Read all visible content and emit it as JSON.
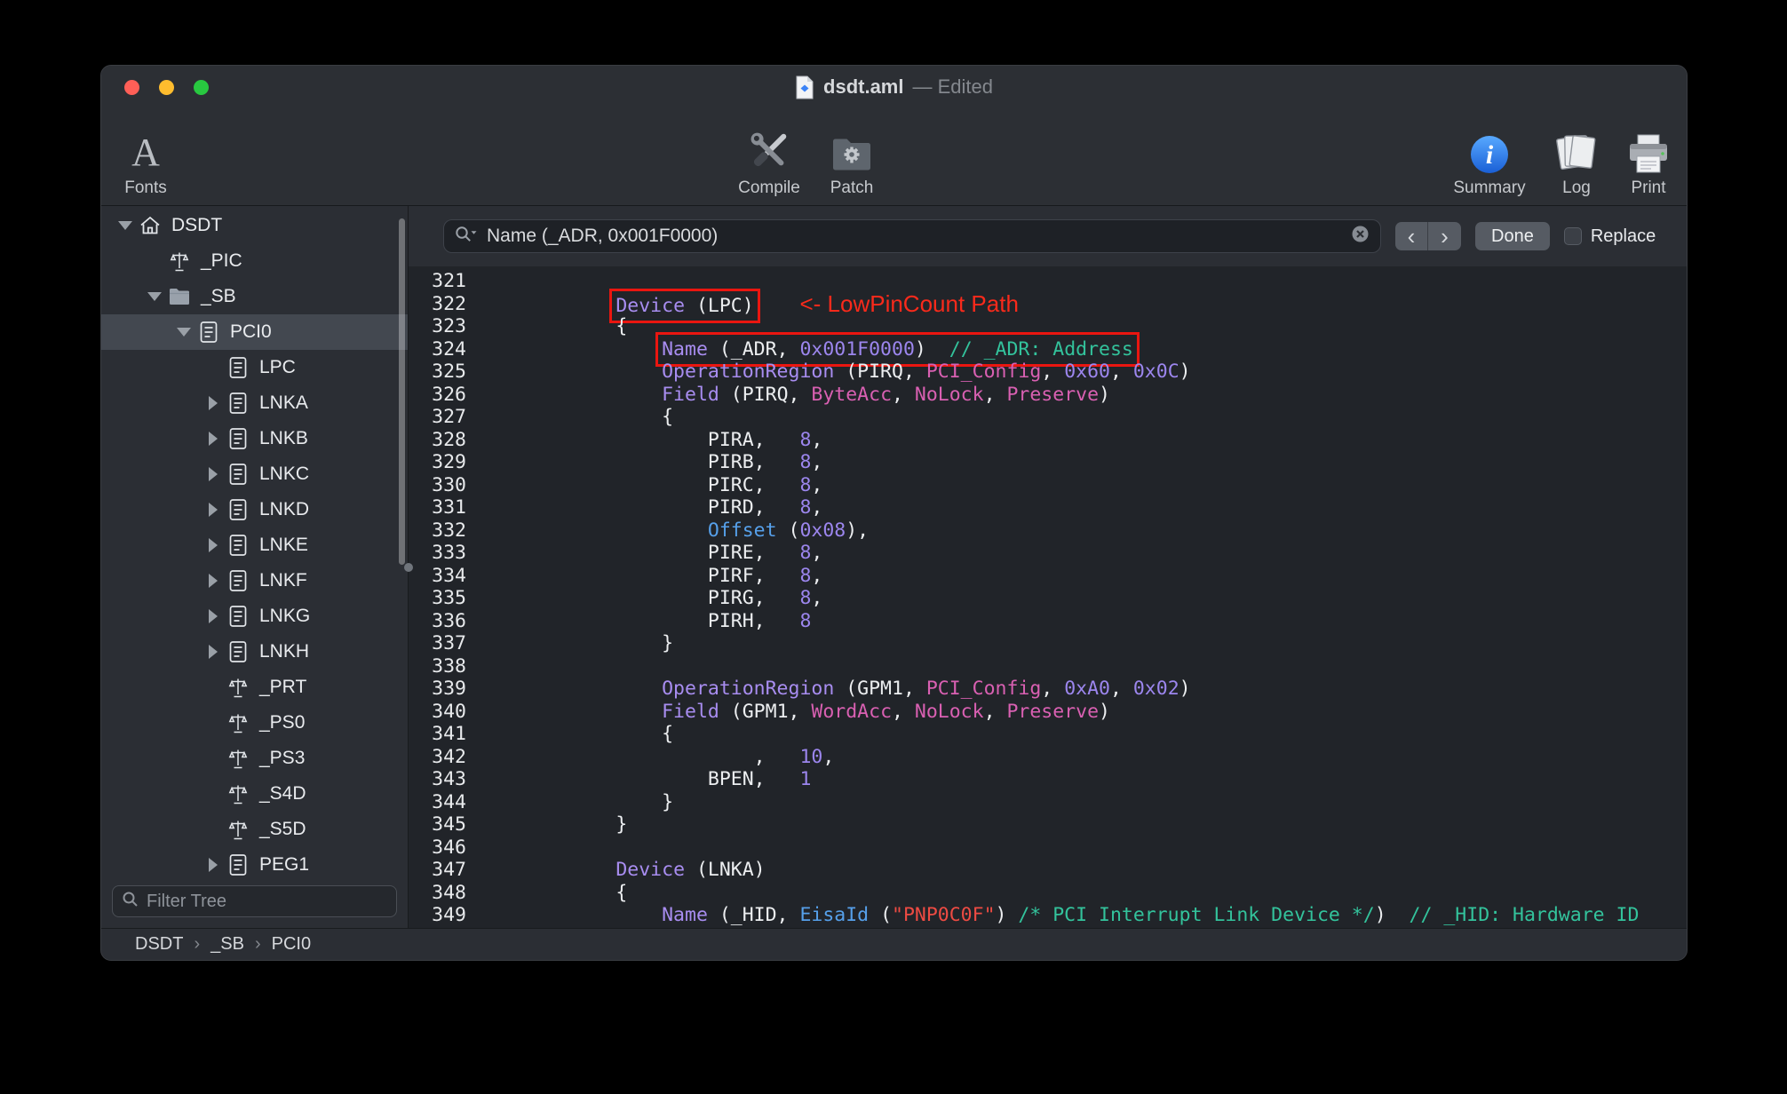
{
  "window": {
    "title_file": "dsdt.aml",
    "title_suffix": "— Edited"
  },
  "toolbar": {
    "items": [
      {
        "label": "Fonts"
      },
      {
        "label": "Compile"
      },
      {
        "label": "Patch"
      },
      {
        "label": "Summary"
      },
      {
        "label": "Log"
      },
      {
        "label": "Print"
      }
    ]
  },
  "sidebar": {
    "filter_placeholder": "Filter Tree",
    "tree": [
      {
        "label": "DSDT",
        "depth": 0,
        "icon": "house",
        "disclosure": "open",
        "selected": false
      },
      {
        "label": "_PIC",
        "depth": 1,
        "icon": "method",
        "disclosure": "none",
        "selected": false
      },
      {
        "label": "_SB",
        "depth": 1,
        "icon": "folder",
        "disclosure": "open",
        "selected": false
      },
      {
        "label": "PCI0",
        "depth": 2,
        "icon": "device",
        "disclosure": "open",
        "selected": true
      },
      {
        "label": "LPC",
        "depth": 3,
        "icon": "device",
        "disclosure": "none",
        "selected": false
      },
      {
        "label": "LNKA",
        "depth": 3,
        "icon": "device",
        "disclosure": "closed",
        "selected": false
      },
      {
        "label": "LNKB",
        "depth": 3,
        "icon": "device",
        "disclosure": "closed",
        "selected": false
      },
      {
        "label": "LNKC",
        "depth": 3,
        "icon": "device",
        "disclosure": "closed",
        "selected": false
      },
      {
        "label": "LNKD",
        "depth": 3,
        "icon": "device",
        "disclosure": "closed",
        "selected": false
      },
      {
        "label": "LNKE",
        "depth": 3,
        "icon": "device",
        "disclosure": "closed",
        "selected": false
      },
      {
        "label": "LNKF",
        "depth": 3,
        "icon": "device",
        "disclosure": "closed",
        "selected": false
      },
      {
        "label": "LNKG",
        "depth": 3,
        "icon": "device",
        "disclosure": "closed",
        "selected": false
      },
      {
        "label": "LNKH",
        "depth": 3,
        "icon": "device",
        "disclosure": "closed",
        "selected": false
      },
      {
        "label": "_PRT",
        "depth": 3,
        "icon": "method",
        "disclosure": "none",
        "selected": false
      },
      {
        "label": "_PS0",
        "depth": 3,
        "icon": "method",
        "disclosure": "none",
        "selected": false
      },
      {
        "label": "_PS3",
        "depth": 3,
        "icon": "method",
        "disclosure": "none",
        "selected": false
      },
      {
        "label": "_S4D",
        "depth": 3,
        "icon": "method",
        "disclosure": "none",
        "selected": false
      },
      {
        "label": "_S5D",
        "depth": 3,
        "icon": "method",
        "disclosure": "none",
        "selected": false
      },
      {
        "label": "PEG1",
        "depth": 3,
        "icon": "device",
        "disclosure": "closed",
        "selected": false
      }
    ]
  },
  "findbar": {
    "search_value": "Name (_ADR, 0x001F0000)",
    "prev_label": "‹",
    "next_label": "›",
    "done_label": "Done",
    "replace_label": "Replace",
    "replace_checked": false
  },
  "annotation": {
    "note": "<- LowPinCount Path",
    "box_color": "#ea1610"
  },
  "colors": {
    "traffic_close": "#ff5f57",
    "traffic_minimize": "#febc2e",
    "traffic_zoom": "#28c840",
    "keyword": "#a88df0",
    "number": "#9c86ee",
    "predefined": "#d960b2",
    "comment": "#33c39c",
    "string": "#ee4b43",
    "function": "#56a0ea",
    "annotation_red": "#ea1610"
  },
  "breadcrumb": [
    "DSDT",
    "_SB",
    "PCI0"
  ],
  "editor": {
    "first_line": 321,
    "lines": [
      [],
      [
        {
          "c": "pln",
          "t": "            "
        },
        {
          "box": [
            {
              "c": "kw",
              "t": "Device"
            },
            {
              "c": "pln",
              "t": " (LPC)"
            }
          ]
        },
        {
          "c": "pln",
          "t": "    "
        },
        {
          "c": "note",
          "t": "<- LowPinCount Path"
        }
      ],
      [
        {
          "c": "pln",
          "t": "            {"
        }
      ],
      [
        {
          "c": "pln",
          "t": "                "
        },
        {
          "box": [
            {
              "c": "kw",
              "t": "Name"
            },
            {
              "c": "pln",
              "t": " (_ADR, "
            },
            {
              "c": "num",
              "t": "0x001F0000"
            },
            {
              "c": "pln",
              "t": ")  "
            },
            {
              "c": "com",
              "t": "// _ADR: Address"
            }
          ]
        }
      ],
      [
        {
          "c": "pln",
          "t": "                "
        },
        {
          "c": "kw",
          "t": "OperationRegion"
        },
        {
          "c": "pln",
          "t": " (PIRQ, "
        },
        {
          "c": "pre",
          "t": "PCI_Config"
        },
        {
          "c": "pln",
          "t": ", "
        },
        {
          "c": "num",
          "t": "0x60"
        },
        {
          "c": "pln",
          "t": ", "
        },
        {
          "c": "num",
          "t": "0x0C"
        },
        {
          "c": "pln",
          "t": ")"
        }
      ],
      [
        {
          "c": "pln",
          "t": "                "
        },
        {
          "c": "kw",
          "t": "Field"
        },
        {
          "c": "pln",
          "t": " (PIRQ, "
        },
        {
          "c": "pre",
          "t": "ByteAcc"
        },
        {
          "c": "pln",
          "t": ", "
        },
        {
          "c": "pre",
          "t": "NoLock"
        },
        {
          "c": "pln",
          "t": ", "
        },
        {
          "c": "pre",
          "t": "Preserve"
        },
        {
          "c": "pln",
          "t": ")"
        }
      ],
      [
        {
          "c": "pln",
          "t": "                {"
        }
      ],
      [
        {
          "c": "pln",
          "t": "                    PIRA,   "
        },
        {
          "c": "num",
          "t": "8"
        },
        {
          "c": "pln",
          "t": ","
        }
      ],
      [
        {
          "c": "pln",
          "t": "                    PIRB,   "
        },
        {
          "c": "num",
          "t": "8"
        },
        {
          "c": "pln",
          "t": ","
        }
      ],
      [
        {
          "c": "pln",
          "t": "                    PIRC,   "
        },
        {
          "c": "num",
          "t": "8"
        },
        {
          "c": "pln",
          "t": ","
        }
      ],
      [
        {
          "c": "pln",
          "t": "                    PIRD,   "
        },
        {
          "c": "num",
          "t": "8"
        },
        {
          "c": "pln",
          "t": ","
        }
      ],
      [
        {
          "c": "pln",
          "t": "                    "
        },
        {
          "c": "fn",
          "t": "Offset"
        },
        {
          "c": "pln",
          "t": " ("
        },
        {
          "c": "num",
          "t": "0x08"
        },
        {
          "c": "pln",
          "t": "),"
        }
      ],
      [
        {
          "c": "pln",
          "t": "                    PIRE,   "
        },
        {
          "c": "num",
          "t": "8"
        },
        {
          "c": "pln",
          "t": ","
        }
      ],
      [
        {
          "c": "pln",
          "t": "                    PIRF,   "
        },
        {
          "c": "num",
          "t": "8"
        },
        {
          "c": "pln",
          "t": ","
        }
      ],
      [
        {
          "c": "pln",
          "t": "                    PIRG,   "
        },
        {
          "c": "num",
          "t": "8"
        },
        {
          "c": "pln",
          "t": ","
        }
      ],
      [
        {
          "c": "pln",
          "t": "                    PIRH,   "
        },
        {
          "c": "num",
          "t": "8"
        }
      ],
      [
        {
          "c": "pln",
          "t": "                }"
        }
      ],
      [],
      [
        {
          "c": "pln",
          "t": "                "
        },
        {
          "c": "kw",
          "t": "OperationRegion"
        },
        {
          "c": "pln",
          "t": " (GPM1, "
        },
        {
          "c": "pre",
          "t": "PCI_Config"
        },
        {
          "c": "pln",
          "t": ", "
        },
        {
          "c": "num",
          "t": "0xA0"
        },
        {
          "c": "pln",
          "t": ", "
        },
        {
          "c": "num",
          "t": "0x02"
        },
        {
          "c": "pln",
          "t": ")"
        }
      ],
      [
        {
          "c": "pln",
          "t": "                "
        },
        {
          "c": "kw",
          "t": "Field"
        },
        {
          "c": "pln",
          "t": " (GPM1, "
        },
        {
          "c": "pre",
          "t": "WordAcc"
        },
        {
          "c": "pln",
          "t": ", "
        },
        {
          "c": "pre",
          "t": "NoLock"
        },
        {
          "c": "pln",
          "t": ", "
        },
        {
          "c": "pre",
          "t": "Preserve"
        },
        {
          "c": "pln",
          "t": ")"
        }
      ],
      [
        {
          "c": "pln",
          "t": "                {"
        }
      ],
      [
        {
          "c": "pln",
          "t": "                        ,   "
        },
        {
          "c": "num",
          "t": "10"
        },
        {
          "c": "pln",
          "t": ","
        }
      ],
      [
        {
          "c": "pln",
          "t": "                    BPEN,   "
        },
        {
          "c": "num",
          "t": "1"
        }
      ],
      [
        {
          "c": "pln",
          "t": "                }"
        }
      ],
      [
        {
          "c": "pln",
          "t": "            }"
        }
      ],
      [],
      [
        {
          "c": "pln",
          "t": "            "
        },
        {
          "c": "kw",
          "t": "Device"
        },
        {
          "c": "pln",
          "t": " (LNKA)"
        }
      ],
      [
        {
          "c": "pln",
          "t": "            {"
        }
      ],
      [
        {
          "c": "pln",
          "t": "                "
        },
        {
          "c": "kw",
          "t": "Name"
        },
        {
          "c": "pln",
          "t": " (_HID, "
        },
        {
          "c": "fn",
          "t": "EisaId"
        },
        {
          "c": "pln",
          "t": " ("
        },
        {
          "c": "str",
          "t": "\"PNP0C0F\""
        },
        {
          "c": "pln",
          "t": ") "
        },
        {
          "c": "com",
          "t": "/* PCI Interrupt Link Device */"
        },
        {
          "c": "pln",
          "t": ")  "
        },
        {
          "c": "com",
          "t": "// _HID: Hardware ID"
        }
      ]
    ]
  }
}
